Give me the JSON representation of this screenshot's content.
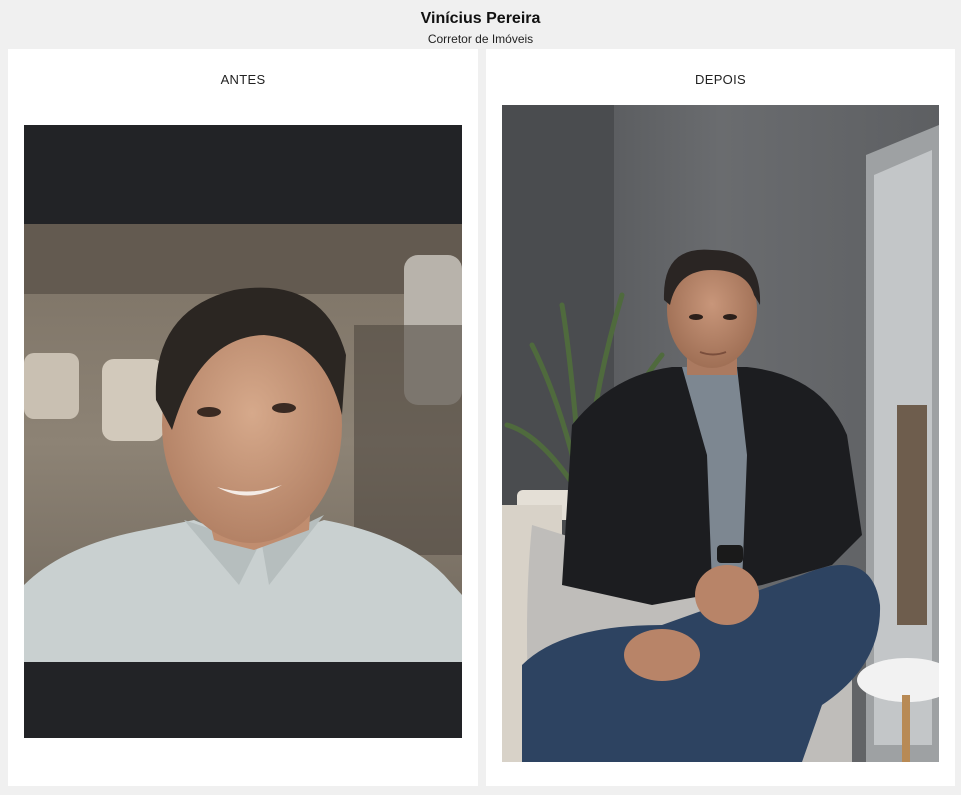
{
  "profile": {
    "name": "Vinícius Pereira",
    "role": "Corretor de Imóveis"
  },
  "before": {
    "label": "ANTES"
  },
  "after": {
    "label": "DEPOIS"
  },
  "colors": {
    "page_bg": "#f0f0f0",
    "card_bg": "#ffffff",
    "letterbox": "#222326"
  }
}
